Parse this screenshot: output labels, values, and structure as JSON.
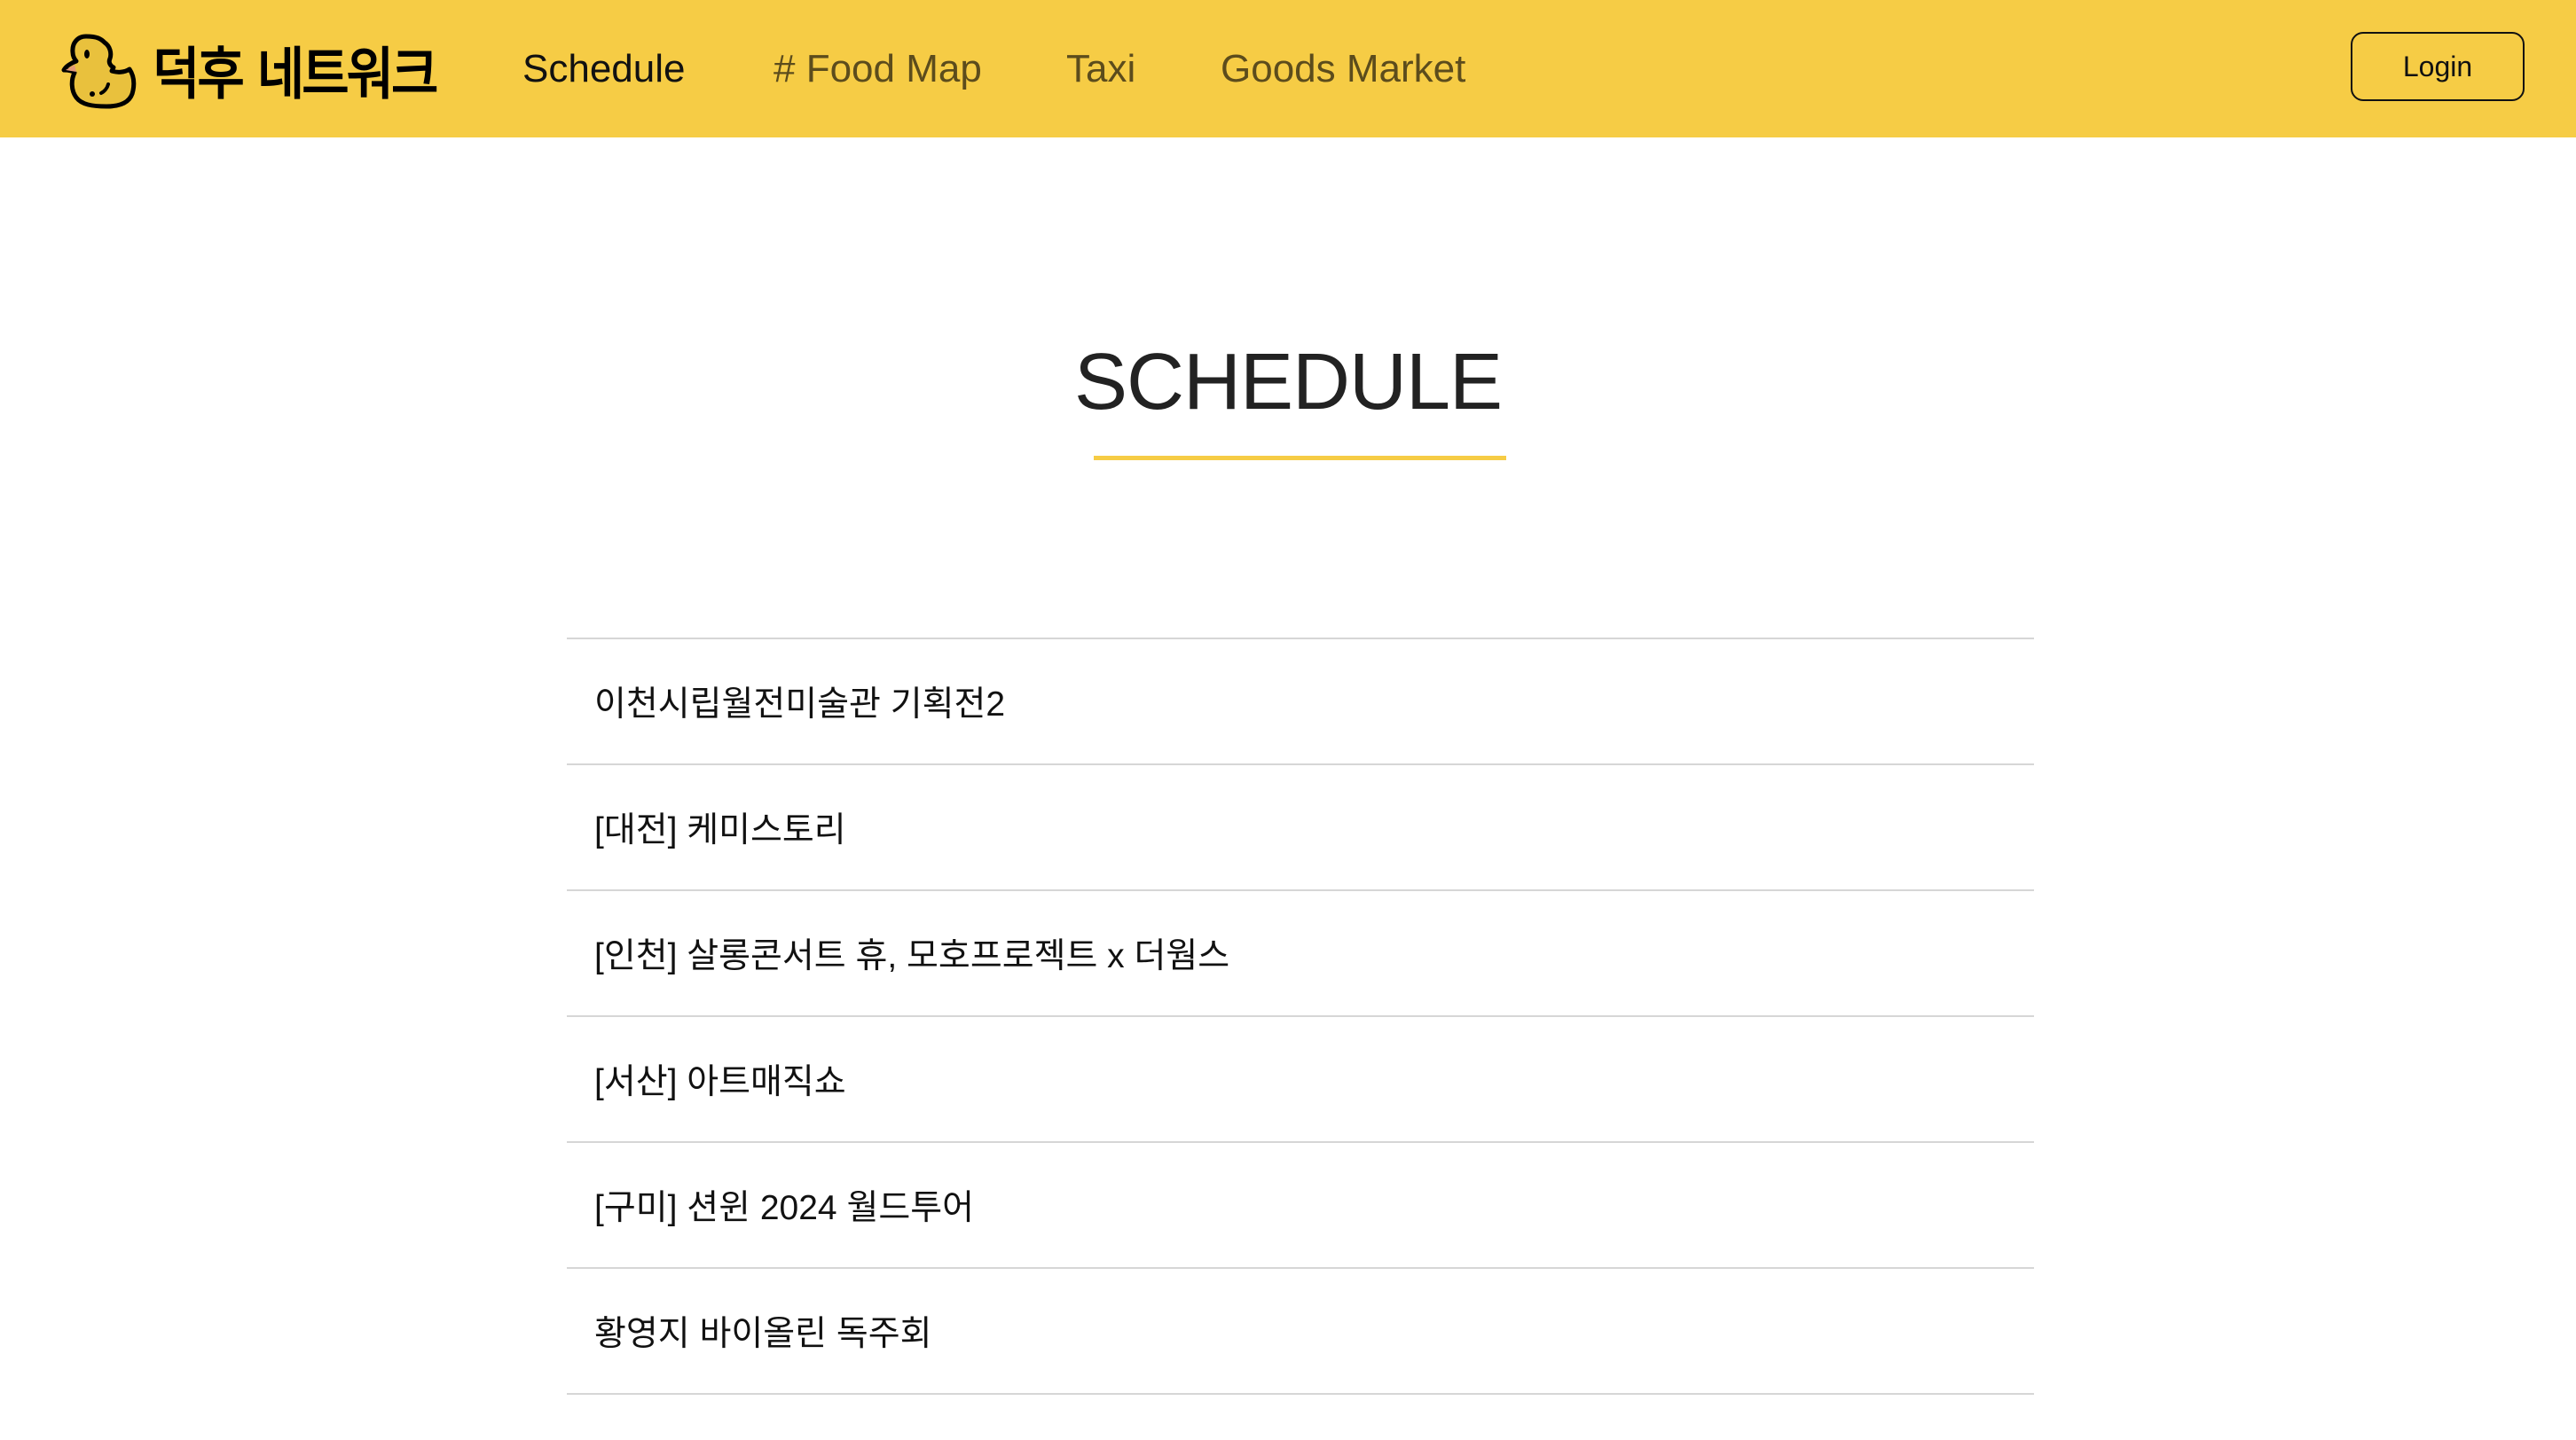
{
  "brand": {
    "name": "덕후 네트워크",
    "color": "#f6cc45",
    "logo_icon": "duck-icon"
  },
  "nav": {
    "items": [
      {
        "label": "Schedule",
        "active": true
      },
      {
        "label": "# Food Map",
        "active": false
      },
      {
        "label": "Taxi",
        "active": false
      },
      {
        "label": "Goods Market",
        "active": false
      }
    ],
    "login_label": "Login"
  },
  "main": {
    "title": "SCHEDULE",
    "schedule_items": [
      "이천시립월전미술관 기획전2",
      "[대전] 케미스토리",
      "[인천] 살롱콘서트 휴, 모호프로젝트 x 더웜스",
      "[서산] 아트매직쇼",
      "[구미] 션윈 2024 월드투어",
      "황영지 바이올린 독주회"
    ]
  }
}
